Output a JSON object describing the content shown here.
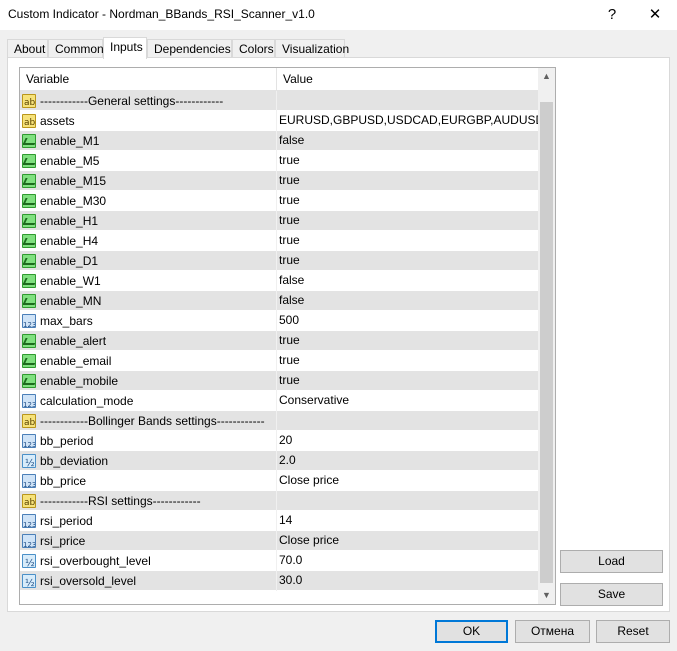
{
  "window": {
    "title": "Custom Indicator - Nordman_BBands_RSI_Scanner_v1.0",
    "help_glyph": "?",
    "close_glyph": "✕"
  },
  "tabs": [
    {
      "label": "About",
      "active": false
    },
    {
      "label": "Common",
      "active": false
    },
    {
      "label": "Inputs",
      "active": true
    },
    {
      "label": "Dependencies",
      "active": false
    },
    {
      "label": "Colors",
      "active": false
    },
    {
      "label": "Visualization",
      "active": false
    }
  ],
  "grid": {
    "columns": {
      "variable": "Variable",
      "value": "Value"
    },
    "rows": [
      {
        "icon": "ab",
        "name": "------------General settings------------",
        "value": ""
      },
      {
        "icon": "ab",
        "name": "assets",
        "value": "EURUSD,GBPUSD,USDCAD,EURGBP,AUDUSD"
      },
      {
        "icon": "bool",
        "name": "enable_M1",
        "value": "false"
      },
      {
        "icon": "bool",
        "name": "enable_M5",
        "value": "true"
      },
      {
        "icon": "bool",
        "name": "enable_M15",
        "value": "true"
      },
      {
        "icon": "bool",
        "name": "enable_M30",
        "value": "true"
      },
      {
        "icon": "bool",
        "name": "enable_H1",
        "value": "true"
      },
      {
        "icon": "bool",
        "name": "enable_H4",
        "value": "true"
      },
      {
        "icon": "bool",
        "name": "enable_D1",
        "value": "true"
      },
      {
        "icon": "bool",
        "name": "enable_W1",
        "value": "false"
      },
      {
        "icon": "bool",
        "name": "enable_MN",
        "value": "false"
      },
      {
        "icon": "int",
        "name": "max_bars",
        "value": "500"
      },
      {
        "icon": "bool",
        "name": "enable_alert",
        "value": "true"
      },
      {
        "icon": "bool",
        "name": "enable_email",
        "value": "true"
      },
      {
        "icon": "bool",
        "name": "enable_mobile",
        "value": "true"
      },
      {
        "icon": "int",
        "name": "calculation_mode",
        "value": "Conservative"
      },
      {
        "icon": "ab",
        "name": "------------Bollinger Bands settings------------",
        "value": ""
      },
      {
        "icon": "int",
        "name": "bb_period",
        "value": "20"
      },
      {
        "icon": "dbl",
        "name": "bb_deviation",
        "value": "2.0"
      },
      {
        "icon": "int",
        "name": "bb_price",
        "value": "Close price"
      },
      {
        "icon": "ab",
        "name": "------------RSI settings------------",
        "value": ""
      },
      {
        "icon": "int",
        "name": "rsi_period",
        "value": "14"
      },
      {
        "icon": "int",
        "name": "rsi_price",
        "value": "Close price"
      },
      {
        "icon": "dbl",
        "name": "rsi_overbought_level",
        "value": "70.0"
      },
      {
        "icon": "dbl",
        "name": "rsi_oversold_level",
        "value": "30.0"
      }
    ]
  },
  "buttons": {
    "load": "Load",
    "save": "Save",
    "ok": "OK",
    "cancel": "Отмена",
    "reset": "Reset"
  }
}
